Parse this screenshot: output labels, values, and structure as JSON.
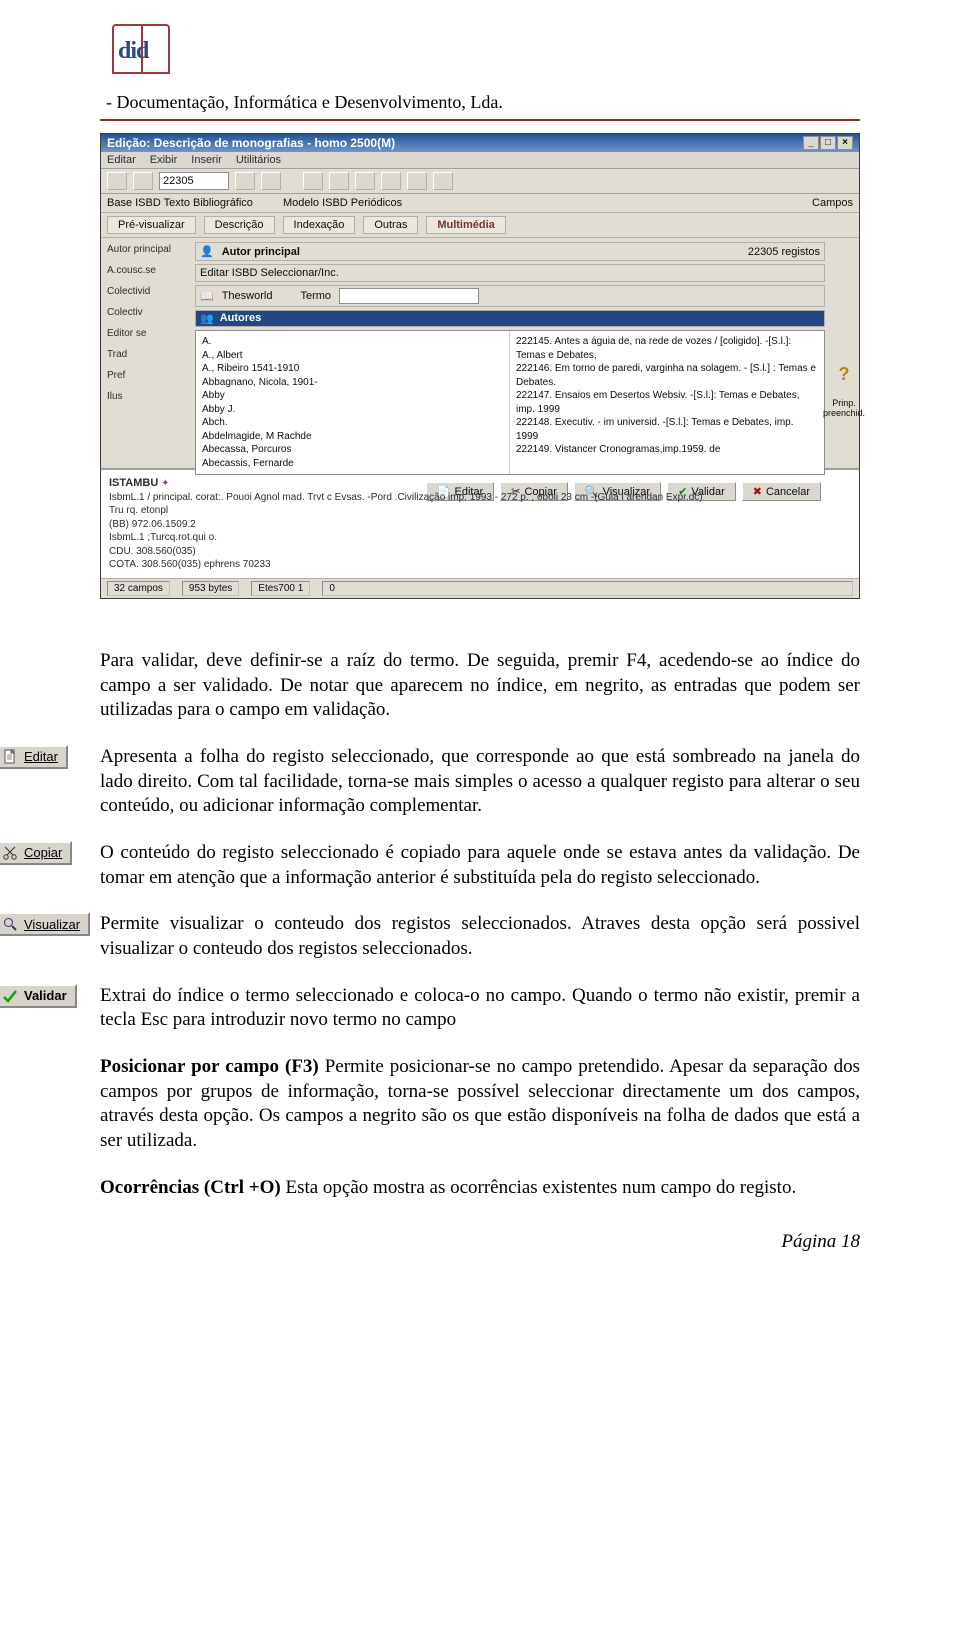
{
  "header": {
    "logo_text": "did",
    "org_line": "- Documentação, Informática e Desenvolvimento, Lda."
  },
  "app": {
    "title": "Edição: Descrição de monografias - homo 2500(M)",
    "menu": [
      "Editar",
      "Exibir",
      "Inserir",
      "Utilitários"
    ],
    "toolbar_count": "22305",
    "sub_labels": {
      "base": "Base  ISBD  Texto Bibliográfico",
      "modelo": "Modelo  ISBD  Periódicos",
      "campos": "Campos"
    },
    "tabs": [
      "Pré-visualizar",
      "Descrição",
      "Indexação",
      "Outras",
      "Multimédia"
    ],
    "left_fields": [
      "Autor principal",
      "A.cousc.se",
      "Colectivid",
      "Colectiv",
      "Editor se",
      "Trad",
      "Pref",
      "Ilus"
    ],
    "inner1_title": "Autor principal",
    "inner1_right": "22305 registos",
    "inner2_label": "Editar  ISBD  Seleccionar/Inc.",
    "inner3_book": "Thesworld",
    "inner3_field": "Termo",
    "idx_title": "Autores",
    "authors": [
      "A.",
      "A., Albert",
      "A., Ribeiro 1541-1910",
      "Abbagnano, Nicola, 1901-",
      "Abby",
      "Abby J.",
      "Abch.",
      "Abdelmagide, M Rachde",
      "Abecassa, Porcuros",
      "Abecassis, Fernarde"
    ],
    "results": [
      "222145. Antes a águia de, na rede de vozes / [coligido]. -[S.l.]: Temas e Debates,",
      "222146. Em torno de paredi, varginha na solagem. - [S.l.] : Temas e Debates.",
      "222147. Ensaios em Desertos Websiv. -[S.l.]: Temas e Debates, imp. 1999",
      "222148. Executiv. - im universid. -[S.l.]: Temas e Debates, imp. 1999",
      "222149. Vistancer Cronogramas,imp.1959. de"
    ],
    "prinp_lab": "Prinp. preenchid.",
    "buttons": {
      "editar": "Editar",
      "copiar": "Copiar",
      "visualizar": "Visualizar",
      "validar": "Validar",
      "cancelar": "Cancelar"
    },
    "bottom_title": "ISTAMBU",
    "bottom_lines": [
      "IsbmL.1 / principal. corat:. Pouoi Agnol  mad. Trvt c Evsas. -Pord .Civilização imp. 1993 - 272 p. , oboli   23 cm -(Guia l arendan Expr.dc)",
      "Tru rq. etonpl",
      "(BB) 972.06.1509.2",
      "IsbmL.1 ;Turcq.rot.qui o.",
      "CDU. 308.560(035)",
      "COTA. 308.560(035)  ephrens  70233"
    ],
    "status": [
      "32 campos",
      "953 bytes",
      "Etes700  1",
      "0"
    ]
  },
  "body": {
    "p1": "Para validar, deve definir-se a raíz do termo. De seguida, premir F4, acedendo-se ao índice do campo a ser validado. De notar que aparecem no índice, em negrito, as entradas que podem ser utilizadas para o campo em validação.",
    "editar_btn": "Editar",
    "editar_text": "Apresenta a folha do registo seleccionado, que corresponde ao que está sombreado na janela do lado direito. Com tal facilidade, torna-se mais simples o acesso a qualquer registo para alterar o seu conteúdo, ou adicionar informação complementar.",
    "copiar_btn": "Copiar",
    "copiar_text": "O conteúdo do registo seleccionado é copiado para aquele onde se estava antes da validação. De tomar em atenção que a informação anterior é substituída pela do registo seleccionado.",
    "visualizar_btn": "Visualizar",
    "visualizar_text": "Permite visualizar o conteudo dos registos seleccionados. Atraves desta opção será possivel visualizar o conteudo dos registos seleccionados.",
    "validar_btn": "Validar",
    "validar_text": "Extrai do índice o termo seleccionado e coloca-o no campo. Quando o termo não existir, premir a tecla Esc para introduzir novo termo no campo",
    "posicionar_bold": "Posicionar por campo (F3) ",
    "posicionar_text": "Permite posicionar-se no campo pretendido. Apesar da separação dos campos por grupos de informação, torna-se possível seleccionar directamente um dos campos, através desta opção. Os campos a negrito são os que estão disponíveis na folha de dados que está a ser utilizada.",
    "ocorrencias_bold": "Ocorrências (Ctrl +O) ",
    "ocorrencias_text": "Esta opção mostra as ocorrências existentes num campo do registo."
  },
  "footer": {
    "page_label": "Página 18"
  }
}
